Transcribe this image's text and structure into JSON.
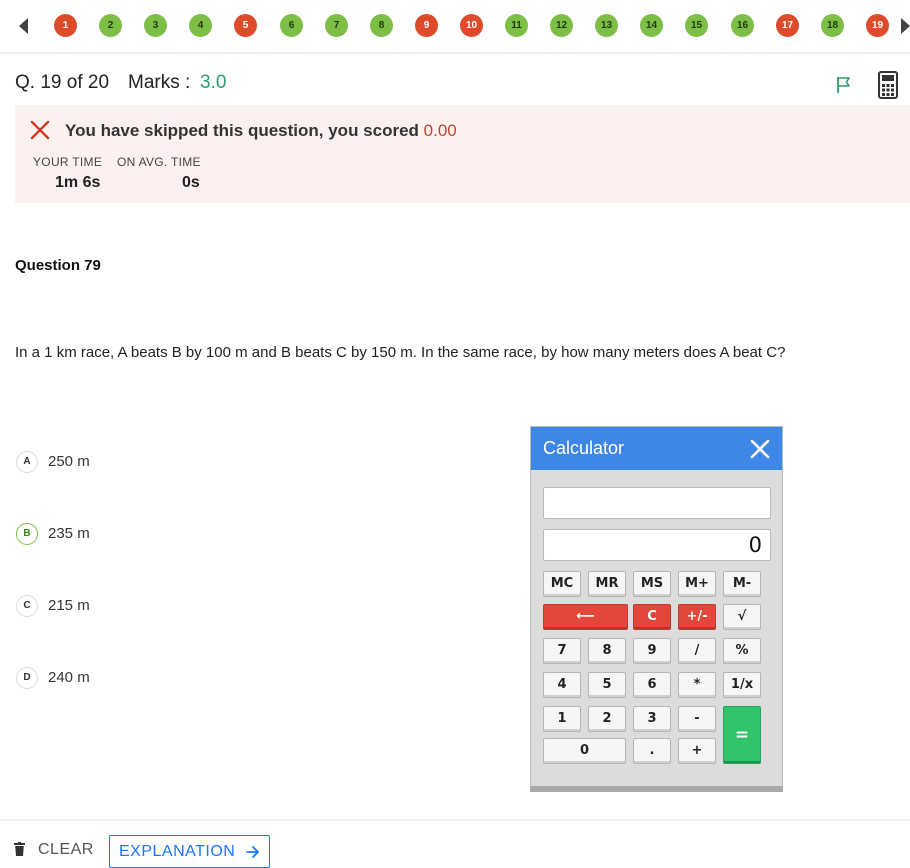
{
  "nav": {
    "questions": [
      {
        "n": "1",
        "status": "skipped"
      },
      {
        "n": "2",
        "status": "correct"
      },
      {
        "n": "3",
        "status": "correct"
      },
      {
        "n": "4",
        "status": "correct"
      },
      {
        "n": "5",
        "status": "skipped"
      },
      {
        "n": "6",
        "status": "correct"
      },
      {
        "n": "7",
        "status": "correct"
      },
      {
        "n": "8",
        "status": "correct"
      },
      {
        "n": "9",
        "status": "skipped"
      },
      {
        "n": "10",
        "status": "skipped"
      },
      {
        "n": "11",
        "status": "correct"
      },
      {
        "n": "12",
        "status": "correct"
      },
      {
        "n": "13",
        "status": "correct"
      },
      {
        "n": "14",
        "status": "correct"
      },
      {
        "n": "15",
        "status": "correct"
      },
      {
        "n": "16",
        "status": "correct"
      },
      {
        "n": "17",
        "status": "skipped"
      },
      {
        "n": "18",
        "status": "correct"
      },
      {
        "n": "19",
        "status": "skipped"
      }
    ],
    "colors": {
      "skipped": "#dd4b2b",
      "correct": "#7dbf46"
    }
  },
  "header": {
    "question_counter": "Q. 19 of 20",
    "marks_label": "Marks :",
    "marks_value": "3.0",
    "icons": [
      "flag-icon",
      "calculator-icon"
    ]
  },
  "result": {
    "message": "You have skipped this question, you scored",
    "score": "0.00",
    "your_time_label": "YOUR TIME",
    "your_time": "1m 6s",
    "avg_time_label": "ON AVG. TIME",
    "avg_time": "0s"
  },
  "question": {
    "title": "Question 79",
    "text": "In a 1 km race, A beats B by 100 m and B beats C by 150 m. In the same race, by how many meters does A beat C?",
    "options": [
      {
        "letter": "A",
        "text": "250 m",
        "correct": false
      },
      {
        "letter": "B",
        "text": "235 m",
        "correct": true
      },
      {
        "letter": "C",
        "text": "215 m",
        "correct": false
      },
      {
        "letter": "D",
        "text": "240 m",
        "correct": false
      }
    ]
  },
  "calculator": {
    "title": "Calculator",
    "input_value": "",
    "display": "0",
    "keys": {
      "mc": "MC",
      "mr": "MR",
      "ms": "MS",
      "mplus": "M+",
      "mminus": "M-",
      "back": "⟵",
      "clear": "C",
      "sign": "+/-",
      "sqrt": "√",
      "k7": "7",
      "k8": "8",
      "k9": "9",
      "div": "/",
      "pct": "%",
      "k4": "4",
      "k5": "5",
      "k6": "6",
      "mul": "*",
      "inv": "1/x",
      "k1": "1",
      "k2": "2",
      "k3": "3",
      "sub": "-",
      "eq": "=",
      "k0": "0",
      "dot": ".",
      "add": "+"
    }
  },
  "footer": {
    "clear_label": "CLEAR",
    "explanation_label": "EXPLANATION"
  }
}
